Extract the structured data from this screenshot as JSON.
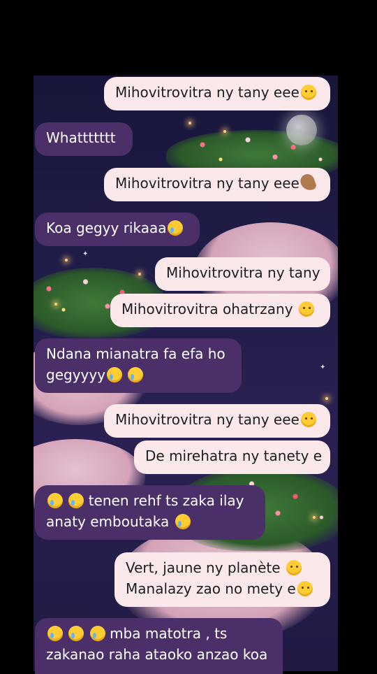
{
  "messages": [
    {
      "side": "out",
      "text": "Mihovitrovitra ny tany eee",
      "emoji": "smirk-emoji"
    },
    {
      "side": "in",
      "text": "Whattttttt",
      "emoji": ""
    },
    {
      "side": "out",
      "text": "Mihovitrovitra ny tany eee",
      "emoji": "pinched-fingers-emoji"
    },
    {
      "side": "in",
      "text": "Koa gegyy rikaaa",
      "emoji": "crying-face-emoji"
    },
    {
      "side": "out",
      "text": "Mihovitrovitra ny tany",
      "emoji": ""
    },
    {
      "side": "out",
      "text": "Mihovitrovitra ohatrzany",
      "emoji": "raised-eyebrow-emoji"
    },
    {
      "side": "in",
      "text_lines": [
        "Ndana mianatra fa efa ho",
        "gegyyyy"
      ],
      "emoji": "crying-face-emoji x2"
    },
    {
      "side": "out",
      "text": "Mihovitrovitra ny tany eee",
      "emoji": "sneezing-face-emoji"
    },
    {
      "side": "out",
      "text": "De mirehatra ny tanety e",
      "emoji": ""
    },
    {
      "side": "in",
      "text_lines": [
        "tenen rehf ts zaka ilay",
        "anaty emboutaka"
      ],
      "emoji": "crying-face-emoji x3"
    },
    {
      "side": "out",
      "text_lines": [
        "Vert, jaune ny planète",
        "Manalazy zao no mety e"
      ],
      "emoji": "yawning-face-emoji, eye-roll-emoji"
    },
    {
      "side": "in",
      "text_lines": [
        "mba matotra , ts",
        "zakanao raha ataoko anzao koa"
      ],
      "emoji": "crying-face-emoji x3"
    }
  ],
  "colors": {
    "outgoing_bubble": "#fbe8ea",
    "incoming_bubble": "#4b2f69",
    "background": "#1f1a44"
  }
}
